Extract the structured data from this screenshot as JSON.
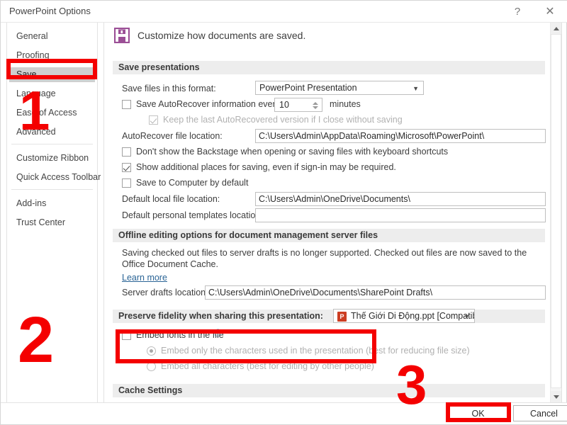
{
  "window": {
    "title": "PowerPoint Options",
    "help_icon": "question-mark-icon",
    "close_icon": "close-icon"
  },
  "sidebar": {
    "items": [
      {
        "label": "General",
        "selected": false
      },
      {
        "label": "Proofing",
        "selected": false
      },
      {
        "label": "Save",
        "selected": true
      },
      {
        "label": "Language",
        "selected": false
      },
      {
        "label": "Ease of Access",
        "selected": false
      },
      {
        "label": "Advanced",
        "selected": false
      },
      {
        "label": "Customize Ribbon",
        "selected": false
      },
      {
        "label": "Quick Access Toolbar",
        "selected": false
      },
      {
        "label": "Add-ins",
        "selected": false
      },
      {
        "label": "Trust Center",
        "selected": false
      }
    ]
  },
  "pane": {
    "header": "Customize how documents are saved.",
    "header_icon": "floppy-disk-save-icon",
    "header_icon_color": "#9B4F96"
  },
  "save_presentations": {
    "section_title": "Save presentations",
    "format_label": "Save files in this format:",
    "format_value": "PowerPoint Presentation",
    "autorecover_label": "Save AutoRecover information every",
    "autorecover_checked": false,
    "autorecover_minutes": "10",
    "minutes_label": "minutes",
    "keep_last_label": "Keep the last AutoRecovered version if I close without saving",
    "keep_last_checked": true,
    "keep_last_disabled": true,
    "autorecover_location_label": "AutoRecover file location:",
    "autorecover_location_value": "C:\\Users\\Admin\\AppData\\Roaming\\Microsoft\\PowerPoint\\",
    "backstage_label": "Don't show the Backstage when opening or saving files with keyboard shortcuts",
    "backstage_checked": false,
    "additional_places_label": "Show additional places for saving, even if sign-in may be required.",
    "additional_places_checked": true,
    "save_to_computer_label": "Save to Computer by default",
    "save_to_computer_checked": false,
    "default_local_label": "Default local file location:",
    "default_local_value": "C:\\Users\\Admin\\OneDrive\\Documents\\",
    "default_templates_label": "Default personal templates location:",
    "default_templates_value": ""
  },
  "offline_editing": {
    "section_title": "Offline editing options for document management server files",
    "description": "Saving checked out files to server drafts is no longer supported. Checked out files are now saved to the Office Document Cache.",
    "learn_more": "Learn more",
    "server_drafts_label": "Server drafts location:",
    "server_drafts_value": "C:\\Users\\Admin\\OneDrive\\Documents\\SharePoint Drafts\\"
  },
  "preserve_fidelity": {
    "section_title": "Preserve fidelity when sharing this presentation:",
    "file_combo_value": "Thế Giới Di Động.ppt [Compatibility M...",
    "file_combo_icon": "powerpoint-file-icon",
    "embed_fonts_label": "Embed fonts in the file",
    "embed_fonts_checked": false,
    "embed_info_icon": "info-icon",
    "embed_only_label": "Embed only the characters used in the presentation (best for reducing file size)",
    "embed_only_selected": true,
    "embed_all_label": "Embed all characters (best for editing by other people)",
    "embed_all_selected": false
  },
  "cache_settings": {
    "section_title": "Cache Settings"
  },
  "footer": {
    "ok_label": "OK",
    "cancel_label": "Cancel"
  },
  "annotations": {
    "color": "#f40000",
    "step1": "1",
    "step2": "2",
    "step3": "3"
  },
  "scrollbar": {
    "up_icon": "scroll-up-arrow-icon",
    "down_icon": "scroll-down-arrow-icon"
  }
}
